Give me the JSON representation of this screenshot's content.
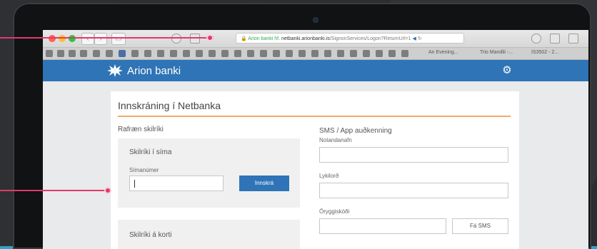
{
  "browser": {
    "url_prefix": "Arion banki hf.",
    "url_domain": "netbanki.arionbanki.is",
    "url_path": "/SignonServices/Logon?ReturnUrl=1",
    "bookmark_tabs": [
      "An Evening...",
      "Trio Mandili -...",
      "IS3502 - 2..."
    ]
  },
  "site": {
    "brand": "Arion banki"
  },
  "login": {
    "title": "Innskráning í Netbanka",
    "left_section": "Rafræn skilríki",
    "mobile_panel_title": "Skilríki í síma",
    "phone_label": "Símanúmer",
    "phone_value": "",
    "login_button": "Innskrá",
    "card_panel_title": "Skilríki á korti",
    "right_section": "SMS / App auðkenning",
    "username_label": "Notandanafn",
    "username_value": "",
    "password_label": "Lykilorð",
    "password_value": "",
    "security_code_label": "Öryggiskóði",
    "security_code_value": "",
    "sms_button": "Fá SMS"
  },
  "colors": {
    "brand_blue": "#2f74b6",
    "accent_orange": "#f0a86b",
    "callout_pink": "#e23a6a"
  },
  "icons": {
    "settings": "gear-icon",
    "logo_mark": "arion-logo-icon"
  }
}
